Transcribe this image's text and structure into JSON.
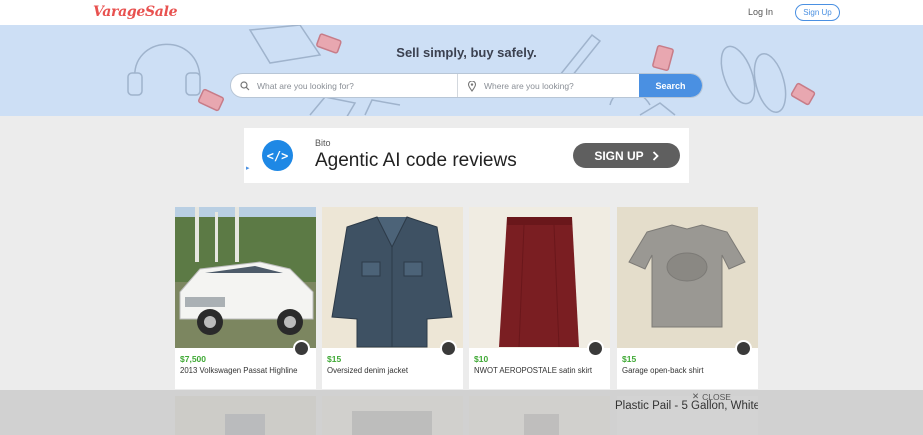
{
  "nav": {
    "logo": "VarageSale",
    "login": "Log In",
    "signup": "Sign Up"
  },
  "hero": {
    "tagline": "Sell simply, buy safely.",
    "search_what_placeholder": "What are you looking for?",
    "search_where_placeholder": "Where are you looking?",
    "search_button": "Search"
  },
  "ad": {
    "brand": "Bito",
    "headline": "Agentic AI code reviews",
    "cta": "SIGN UP",
    "cta_icon": "chevron-right-icon",
    "icon_glyph": "</>",
    "icon_color": "#1e88e5"
  },
  "listings": [
    {
      "price": "$7,500",
      "title": "2013 Volkswagen Passat Highline",
      "image": "white-car"
    },
    {
      "price": "$15",
      "title": "Oversized denim jacket",
      "image": "denim-jacket"
    },
    {
      "price": "$10",
      "title": "NWOT AEROPOSTALE satin skirt",
      "image": "red-skirt"
    },
    {
      "price": "$15",
      "title": "Garage open-back shirt",
      "image": "grey-shirt"
    }
  ],
  "bottom_ad": {
    "close": "CLOSE",
    "text": "Plastic Pail - 5 Gallon, White"
  },
  "colors": {
    "brand": "#e8514f",
    "accent": "#4a90e2",
    "price": "#3fa935",
    "hero_bg": "#cddff5"
  }
}
